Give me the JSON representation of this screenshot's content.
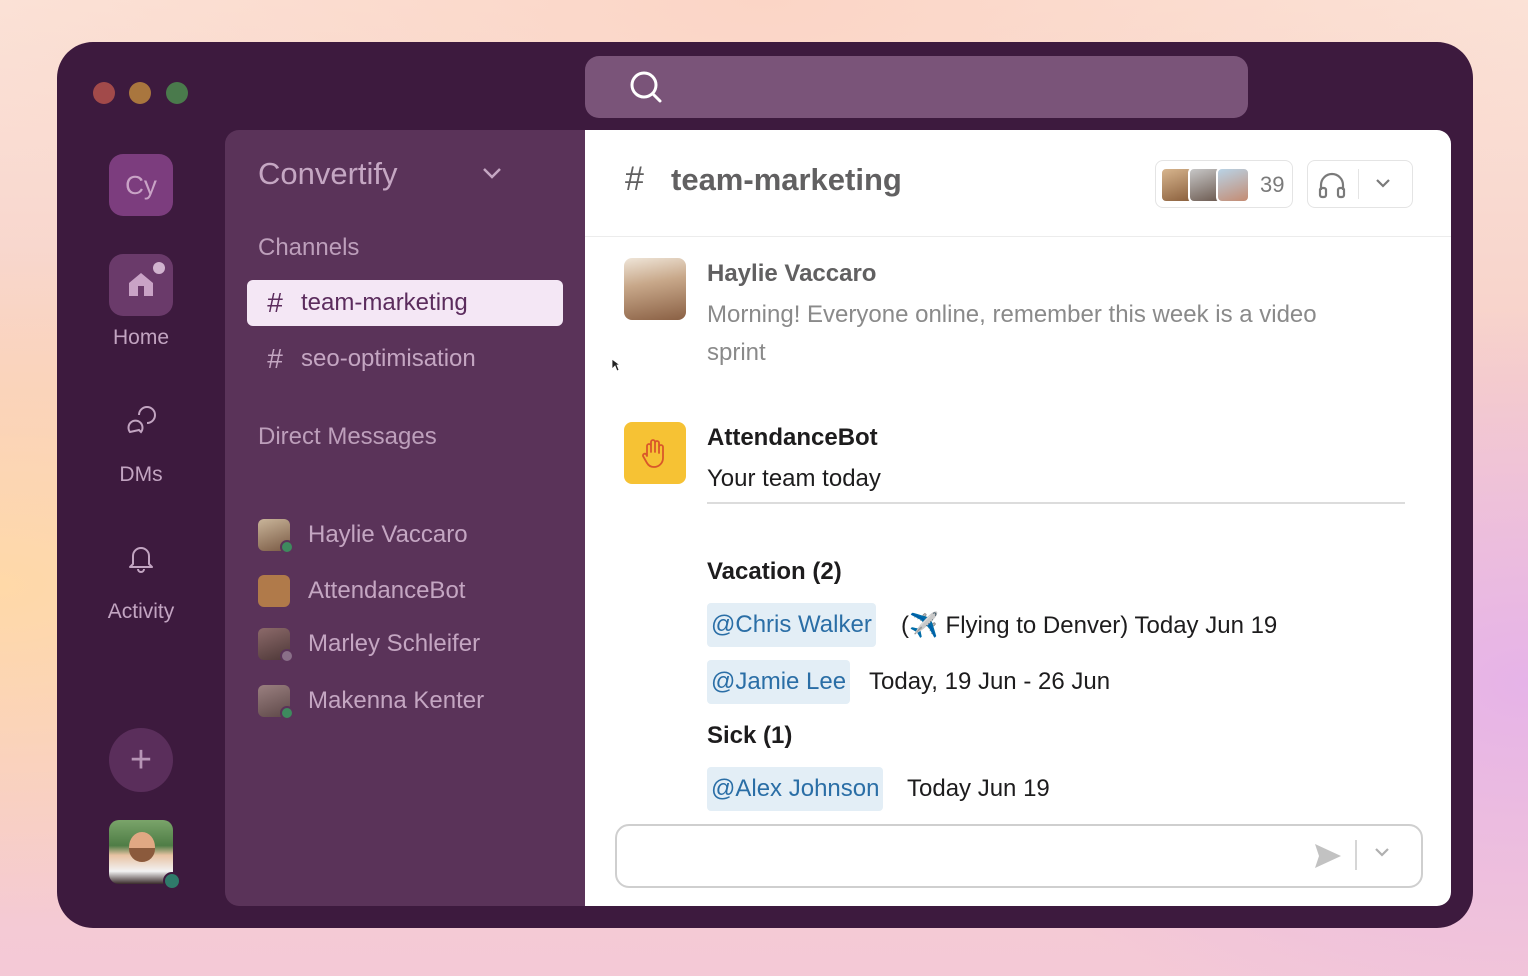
{
  "workspace": {
    "initials": "Cy",
    "name": "Convertify"
  },
  "rail": {
    "home_label": "Home",
    "dms_label": "DMs",
    "activity_label": "Activity",
    "add_label": "+"
  },
  "sidebar": {
    "channels_heading": "Channels",
    "channels": [
      {
        "hash": "#",
        "label": "team-marketing",
        "active": true
      },
      {
        "hash": "#",
        "label": "seo-optimisation",
        "active": false
      }
    ],
    "dm_heading": "Direct Messages",
    "dms": [
      {
        "label": "Haylie Vaccaro"
      },
      {
        "label": "AttendanceBot"
      },
      {
        "label": "Marley Schleifer"
      },
      {
        "label": "Makenna Kenter"
      }
    ]
  },
  "channel": {
    "hash": "#",
    "name": "team-marketing",
    "member_count": "39"
  },
  "messages": {
    "first": {
      "sender": "Haylie Vaccaro",
      "text": "Morning! Everyone online, remember this week is a video sprint"
    },
    "bot": {
      "sender": "AttendanceBot",
      "intro": "Your team today",
      "vacation_heading": "Vacation (2)",
      "vacation": [
        {
          "mention": "@Chris Walker",
          "detail": "(✈️ Flying to Denver) Today Jun 19"
        },
        {
          "mention": "@Jamie Lee",
          "detail": "Today, 19 Jun - 26 Jun"
        }
      ],
      "sick_heading": "Sick (1)",
      "sick": [
        {
          "mention": "@Alex Johnson",
          "detail": "Today Jun 19"
        }
      ]
    }
  },
  "composer": {
    "value": ""
  },
  "colors": {
    "window_bg": "#3d1a3e",
    "sidebar_bg": "#5a3359",
    "active_channel_bg": "#f4e7f5",
    "mention_bg": "#e3eef6",
    "mention_text": "#2a6ea6",
    "bot_avatar": "#f6c234"
  }
}
